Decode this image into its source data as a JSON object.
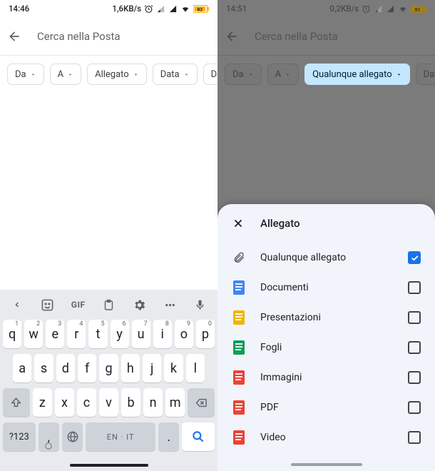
{
  "left": {
    "status": {
      "time": "14:46",
      "net": "1,6KB/s",
      "battery": "82"
    },
    "search_placeholder": "Cerca nella Posta",
    "chips": [
      {
        "label": "Da"
      },
      {
        "label": "A"
      },
      {
        "label": "Allegato"
      },
      {
        "label": "Data"
      },
      {
        "label": "Da leg"
      }
    ],
    "keyboard": {
      "row1": [
        {
          "k": "q",
          "s": "1"
        },
        {
          "k": "w",
          "s": "2"
        },
        {
          "k": "e",
          "s": "3"
        },
        {
          "k": "r",
          "s": "4"
        },
        {
          "k": "t",
          "s": "5"
        },
        {
          "k": "y",
          "s": "6"
        },
        {
          "k": "u",
          "s": "7"
        },
        {
          "k": "i",
          "s": "8"
        },
        {
          "k": "o",
          "s": "9"
        },
        {
          "k": "p",
          "s": "0"
        }
      ],
      "row2": [
        "a",
        "s",
        "d",
        "f",
        "g",
        "h",
        "j",
        "k",
        "l"
      ],
      "row3": [
        "z",
        "x",
        "c",
        "v",
        "b",
        "n",
        "m"
      ],
      "symkey": "?123",
      "spacelabel": "EN · IT"
    }
  },
  "right": {
    "status": {
      "time": "14:51",
      "net": "0,2KB/s",
      "battery": "82"
    },
    "search_placeholder": "Cerca nella Posta",
    "chips": [
      {
        "label": "Da"
      },
      {
        "label": "A"
      },
      {
        "label": "Qualunque allegato",
        "selected": true
      },
      {
        "label": "Data"
      }
    ],
    "sheet": {
      "title": "Allegato",
      "items": [
        {
          "icon": "clip",
          "label": "Qualunque allegato",
          "checked": true,
          "color": "#5f6368"
        },
        {
          "icon": "doc",
          "label": "Documenti",
          "color": "#4285f4"
        },
        {
          "icon": "doc",
          "label": "Presentazioni",
          "color": "#f4b400"
        },
        {
          "icon": "doc",
          "label": "Fogli",
          "color": "#0f9d58"
        },
        {
          "icon": "doc",
          "label": "Immagini",
          "color": "#ea4335"
        },
        {
          "icon": "doc",
          "label": "PDF",
          "color": "#ea4335"
        },
        {
          "icon": "doc",
          "label": "Video",
          "color": "#ea4335"
        }
      ]
    }
  }
}
